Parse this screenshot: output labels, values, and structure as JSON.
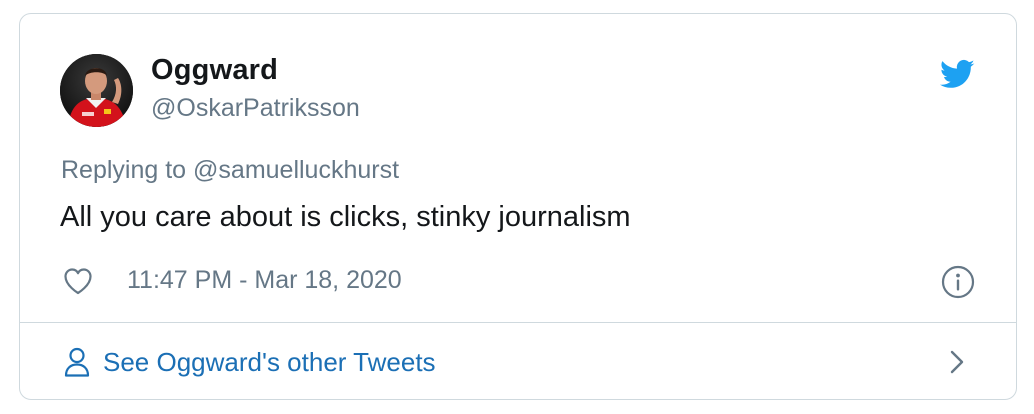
{
  "author": {
    "display_name": "Oggward",
    "handle": "@OskarPatriksson",
    "avatar": "avatar-photo"
  },
  "reply": {
    "prefix": "Replying to",
    "mention": "@samuelluckhurst"
  },
  "tweet": {
    "text": "All you care about is clicks, stinky journalism",
    "timestamp": "11:47 PM - Mar 18, 2020"
  },
  "footer": {
    "label": "See Oggward's other Tweets"
  },
  "icons": {
    "brand": "twitter-bird-icon",
    "like": "heart-icon",
    "info": "info-icon",
    "user": "user-icon",
    "chevron": "chevron-right-icon"
  },
  "colors": {
    "brand": "#1da1f2",
    "link": "#1b6fb5",
    "secondary_text": "#657786",
    "border": "#cfd9de"
  }
}
